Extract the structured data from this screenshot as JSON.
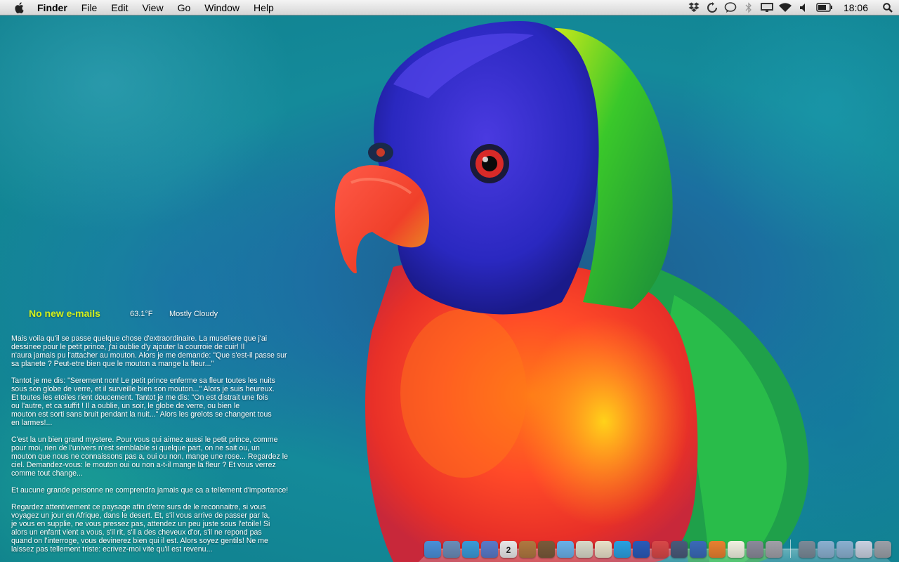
{
  "menubar": {
    "apple_icon": "apple-icon",
    "app_name": "Finder",
    "menus": [
      "File",
      "Edit",
      "View",
      "Go",
      "Window",
      "Help"
    ],
    "status_icons": [
      "dropbox-icon",
      "sync-icon",
      "chat-bubble-icon",
      "bluetooth-icon",
      "display-icon",
      "wifi-icon",
      "volume-icon",
      "battery-icon"
    ],
    "clock": "18:06",
    "spotlight_icon": "spotlight-search-icon"
  },
  "widgets": {
    "mail_status": "No new e-mails",
    "temperature": "63.1°F",
    "weather_condition": "Mostly Cloudy"
  },
  "story": [
    "Mais voila qu'il se passe quelque chose d'extraordinaire. La museliere que j'ai\ndessinee pour le petit prince, j'ai oublie d'y ajouter la courroie de cuir! Il\nn'aura jamais pu l'attacher au mouton. Alors je me demande: \"Que s'est-il passe sur\nsa planete ? Peut-etre bien que le mouton a mange la fleur...\"",
    "Tantot je me dis: \"Serement non! Le petit prince enferme sa fleur toutes les nuits\nsous son globe de verre, et il surveille bien son mouton...\" Alors je suis heureux.\nEt toutes les etoiles rient doucement. Tantot je me dis: \"On est distrait une fois\nou l'autre, et ca suffit ! Il a oublie, un soir, le globe de verre, ou bien le\nmouton est sorti sans bruit pendant la nuit...\" Alors les grelots se changent tous\nen larmes!...",
    "C'est la un bien grand mystere. Pour vous qui aimez aussi le petit prince, comme\npour moi, rien de l'univers n'est semblable si quelque part, on ne sait ou, un\nmouton que nous ne connaissons pas a, oui ou non, mange une rose... Regardez le\nciel. Demandez-vous: le mouton oui ou non a-t-il mange la fleur ? Et vous verrez\ncomme tout change...",
    "Et aucune grande personne ne comprendra jamais que ca a tellement d'importance!",
    "Regardez attentivement ce paysage afin d'etre surs de le reconnaitre, si vous\nvoyagez un jour en Afrique, dans le desert. Et, s'il vous arrive de passer par la,\nje vous en supplie, ne vous pressez pas, attendez un peu juste sous l'etoile! Si\nalors un enfant vient a vous, s'il rit, s'il a des cheveux d'or, s'il ne repond pas\nquand on l'interroge, vous devinerez bien qui il est. Alors soyez gentils! Ne me\nlaissez pas tellement triste: ecrivez-moi vite qu'il est revenu..."
  ],
  "dock": {
    "apps": [
      {
        "icon": "finder-icon",
        "color": "#4a8fd8"
      },
      {
        "icon": "preview-icon",
        "color": "#6a8cb8"
      },
      {
        "icon": "safari-icon",
        "color": "#3a9ad8"
      },
      {
        "icon": "facetime-icon",
        "color": "#5a7ac8"
      },
      {
        "icon": "calendar-icon",
        "color": "#e8e8e8",
        "text": "2"
      },
      {
        "icon": "coffee-icon",
        "color": "#b07840"
      },
      {
        "icon": "iphoto-icon",
        "color": "#7a5a3a"
      },
      {
        "icon": "itunes-icon",
        "color": "#6ab0e8"
      },
      {
        "icon": "photo-booth-icon",
        "color": "#d8d8c8"
      },
      {
        "icon": "mail-icon",
        "color": "#e8e0c8"
      },
      {
        "icon": "skype-icon",
        "color": "#2aa0e0"
      },
      {
        "icon": "quicktime-icon",
        "color": "#2a5ab8"
      },
      {
        "icon": "app-store-icon",
        "color": "#d84848"
      },
      {
        "icon": "pen-tool-icon",
        "color": "#4a5a7a"
      },
      {
        "icon": "word-icon",
        "color": "#3a6ab8"
      },
      {
        "icon": "powerpoint-icon",
        "color": "#e88030"
      },
      {
        "icon": "textedit-icon",
        "color": "#f0f0e0"
      },
      {
        "icon": "image-capture-icon",
        "color": "#8a8a9a"
      },
      {
        "icon": "system-preferences-icon",
        "color": "#a0a0a8"
      }
    ],
    "stacks": [
      {
        "icon": "network-globe-icon",
        "color": "#7a8a98"
      },
      {
        "icon": "applications-folder-icon",
        "color": "#8ab0d0"
      },
      {
        "icon": "documents-folder-icon",
        "color": "#8ab0d0"
      },
      {
        "icon": "downloads-icon",
        "color": "#c8d0e0"
      },
      {
        "icon": "trash-icon",
        "color": "#9aa0a8"
      }
    ]
  }
}
